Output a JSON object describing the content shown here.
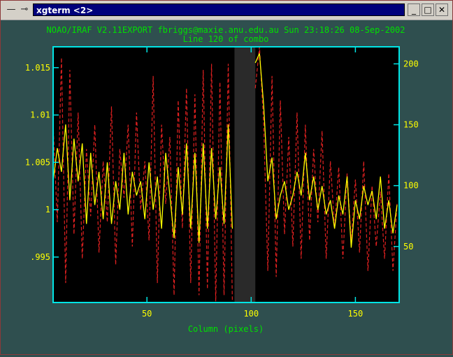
{
  "window": {
    "title": "xgterm <2>",
    "icons": {
      "menu": "window-menu-icon",
      "pin": "pin-icon"
    },
    "buttons": {
      "minimize": "_",
      "maximize": "□",
      "close": "✕"
    }
  },
  "colors": {
    "background": "#2f4f4f",
    "frame": "#00e5e5",
    "header_text": "#00e000",
    "axis_label_text": "#00e000",
    "tick_label_text": "#ffff00",
    "dashed_series": "#e02020",
    "solid_series": "#ffff00",
    "plot_bg": "#000000"
  },
  "header": {
    "line1": "NOAO/IRAF V2.11EXPORT fbriggs@maxie.anu.edu.au Sun 23:18:26 08-Sep-2002",
    "line2": "Line 120 of combo"
  },
  "chart_data": {
    "type": "line",
    "title": "Line 120 of combo",
    "xlabel": "Column (pixels)",
    "ylabel": "",
    "xlim": [
      5,
      171
    ],
    "x_ticks": [
      50,
      100,
      150
    ],
    "x_tick_labels": [
      "50",
      "100",
      "150"
    ],
    "ylim_left": [
      0.9902,
      1.0172
    ],
    "y_ticks_left": [
      0.995,
      1.0,
      1.005,
      1.01,
      1.015
    ],
    "y_tick_labels_left": [
      ".995",
      "1",
      "1.005",
      "1.01",
      "1.015"
    ],
    "ylim_right": [
      4,
      214
    ],
    "y_ticks_right": [
      50,
      100,
      150,
      200
    ],
    "y_tick_labels_right": [
      "50",
      "100",
      "150",
      "200"
    ],
    "gap": [
      92,
      102
    ],
    "series": [
      {
        "axis": "right",
        "style": "dashed",
        "x": [
          5,
          7,
          9,
          11,
          13,
          15,
          17,
          19,
          21,
          23,
          25,
          27,
          29,
          31,
          33,
          35,
          37,
          39,
          41,
          43,
          45,
          47,
          49,
          51,
          53,
          55,
          57,
          59,
          61,
          63,
          65,
          67,
          69,
          71,
          73,
          75,
          77,
          79,
          81,
          83,
          85,
          87,
          89,
          91,
          102,
          104,
          106,
          108,
          110,
          112,
          114,
          116,
          118,
          120,
          122,
          124,
          126,
          128,
          130,
          132,
          134,
          136,
          138,
          140,
          142,
          144,
          146,
          148,
          150,
          152,
          154,
          156,
          158,
          160,
          162,
          164,
          166,
          168,
          170
        ],
        "values": [
          150,
          70,
          205,
          20,
          195,
          60,
          160,
          40,
          130,
          75,
          150,
          45,
          120,
          70,
          165,
          35,
          130,
          90,
          150,
          50,
          160,
          80,
          120,
          55,
          190,
          20,
          150,
          85,
          140,
          10,
          170,
          65,
          180,
          20,
          175,
          10,
          195,
          15,
          200,
          5,
          185,
          10,
          200,
          5,
          180,
          214,
          150,
          30,
          190,
          25,
          170,
          60,
          140,
          50,
          160,
          40,
          150,
          55,
          130,
          70,
          145,
          40,
          120,
          65,
          115,
          40,
          110,
          55,
          105,
          45,
          120,
          30,
          100,
          50,
          95,
          40,
          110,
          30,
          85
        ]
      },
      {
        "axis": "left",
        "style": "solid",
        "x": [
          5,
          7,
          9,
          11,
          13,
          15,
          17,
          19,
          21,
          23,
          25,
          27,
          29,
          31,
          33,
          35,
          37,
          39,
          41,
          43,
          45,
          47,
          49,
          51,
          53,
          55,
          57,
          59,
          61,
          63,
          65,
          67,
          69,
          71,
          73,
          75,
          77,
          79,
          81,
          83,
          85,
          87,
          89,
          91,
          102,
          104,
          106,
          108,
          110,
          112,
          114,
          116,
          118,
          120,
          122,
          124,
          126,
          128,
          130,
          132,
          134,
          136,
          138,
          140,
          142,
          144,
          146,
          148,
          150,
          152,
          154,
          156,
          158,
          160,
          162,
          164,
          166,
          168,
          170
        ],
        "values": [
          1.003,
          1.0065,
          1.004,
          1.009,
          1.001,
          1.0075,
          1.003,
          1.007,
          0.9985,
          1.006,
          1.0005,
          1.004,
          0.999,
          1.005,
          0.9985,
          1.003,
          1.0,
          1.006,
          0.9995,
          1.004,
          1.0015,
          1.003,
          0.999,
          1.005,
          1.0,
          1.0035,
          0.998,
          1.006,
          1.0015,
          0.997,
          1.0045,
          0.9995,
          1.007,
          0.998,
          1.006,
          0.9965,
          1.007,
          0.998,
          1.0065,
          0.999,
          1.0045,
          0.9985,
          1.009,
          0.998,
          1.0155,
          1.0165,
          1.011,
          1.003,
          1.0055,
          0.999,
          1.0015,
          1.003,
          1.0,
          1.0015,
          1.004,
          1.0015,
          1.006,
          1.001,
          1.0035,
          1.0,
          1.0025,
          0.9995,
          1.001,
          0.998,
          1.0015,
          0.9995,
          1.0035,
          0.996,
          1.001,
          0.999,
          1.0025,
          1.0005,
          1.002,
          0.999,
          1.0035,
          0.998,
          1.001,
          0.9975,
          1.0005
        ]
      }
    ]
  },
  "axis_label": "Column (pixels)"
}
